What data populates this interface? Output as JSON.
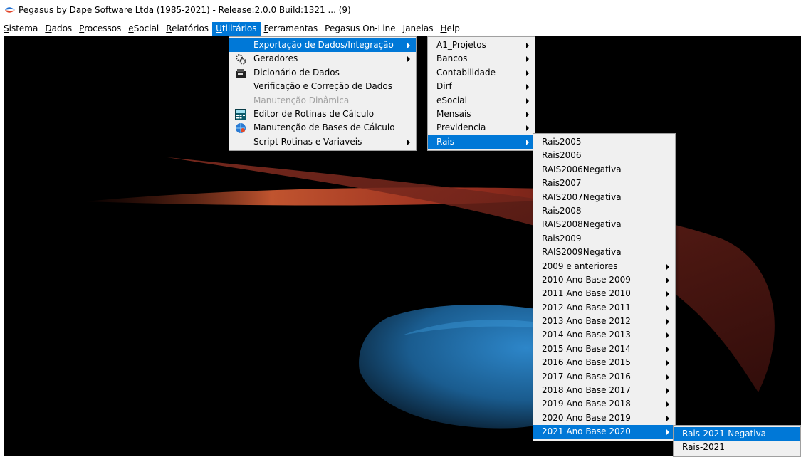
{
  "window": {
    "title": "Pegasus by Dape Software Ltda (1985-2021) - Release:2.0.0  Build:1321 ... (9)"
  },
  "menubar": [
    {
      "id": "sistema",
      "label": "Sistema",
      "ul": "S",
      "rest": "istema"
    },
    {
      "id": "dados",
      "label": "Dados",
      "ul": "D",
      "rest": "ados"
    },
    {
      "id": "processos",
      "label": "Processos",
      "ul": "P",
      "rest": "rocessos"
    },
    {
      "id": "esocial",
      "label": "eSocial",
      "ul": "e",
      "rest": "Social"
    },
    {
      "id": "relatorios",
      "label": "Relatórios",
      "ul": "R",
      "rest": "elatórios"
    },
    {
      "id": "utilitarios",
      "label": "Utilitários",
      "ul": "U",
      "rest": "tilitários",
      "active": true
    },
    {
      "id": "ferramentas",
      "label": "Ferramentas",
      "ul": "F",
      "rest": "erramentas"
    },
    {
      "id": "pegasus-online",
      "label": "Pegasus On-Line",
      "pre": "Pe",
      "ul": "g",
      "rest": "asus On-Line"
    },
    {
      "id": "janelas",
      "label": "Janelas",
      "ul": "J",
      "rest": "anelas"
    },
    {
      "id": "help",
      "label": "Help",
      "ul": "H",
      "rest": "elp"
    }
  ],
  "utilitarios_menu": [
    {
      "id": "exportacao",
      "label": "Exportação de Dados/Integração",
      "sub": true,
      "sel": true,
      "icon": ""
    },
    {
      "id": "geradores",
      "label": "Geradores",
      "sub": true,
      "icon": "gears-icon"
    },
    {
      "id": "dicionario",
      "label": "Dicionário de Dados",
      "icon": "folder-icon"
    },
    {
      "id": "verificacao",
      "label": "Verificação e Correção de Dados",
      "icon": ""
    },
    {
      "id": "manutencao-dinamica",
      "label": "Manutenção Dinâmica",
      "disabled": true,
      "icon": ""
    },
    {
      "id": "editor-rotinas",
      "label": "Editor de Rotinas de Cálculo",
      "icon": "calculator-icon"
    },
    {
      "id": "manutencao-bases",
      "label": "Manutenção de Bases de Cálculo",
      "icon": "globe-person-icon"
    },
    {
      "id": "script-rotinas",
      "label": "Script Rotinas e Variaveis",
      "sub": true,
      "icon": ""
    }
  ],
  "exportacao_menu": [
    {
      "id": "a1-projetos",
      "label": "A1_Projetos",
      "sub": true
    },
    {
      "id": "bancos",
      "label": "Bancos",
      "sub": true
    },
    {
      "id": "contabilidade",
      "label": "Contabilidade",
      "sub": true
    },
    {
      "id": "dirf",
      "label": "Dirf",
      "sub": true
    },
    {
      "id": "esocial",
      "label": "eSocial",
      "sub": true
    },
    {
      "id": "mensais",
      "label": "Mensais",
      "sub": true
    },
    {
      "id": "previdencia",
      "label": "Previdencia",
      "sub": true
    },
    {
      "id": "rais",
      "label": "Rais",
      "sub": true,
      "sel": true
    }
  ],
  "rais_menu": [
    {
      "id": "rais2005",
      "label": "Rais2005"
    },
    {
      "id": "rais2006",
      "label": "Rais2006"
    },
    {
      "id": "rais2006negativa",
      "label": "RAIS2006Negativa"
    },
    {
      "id": "rais2007",
      "label": "Rais2007"
    },
    {
      "id": "rais2007negativa",
      "label": "RAIS2007Negativa"
    },
    {
      "id": "rais2008",
      "label": "Rais2008"
    },
    {
      "id": "rais2008negativa",
      "label": "RAIS2008Negativa"
    },
    {
      "id": "rais2009",
      "label": "Rais2009"
    },
    {
      "id": "rais2009negativa",
      "label": "RAIS2009Negativa"
    },
    {
      "id": "2009-anteriores",
      "label": "2009 e anteriores",
      "sub": true
    },
    {
      "id": "2010-ab-2009",
      "label": "2010 Ano Base 2009",
      "sub": true
    },
    {
      "id": "2011-ab-2010",
      "label": "2011 Ano Base 2010",
      "sub": true
    },
    {
      "id": "2012-ab-2011",
      "label": "2012 Ano Base 2011",
      "sub": true
    },
    {
      "id": "2013-ab-2012",
      "label": "2013 Ano Base 2012",
      "sub": true
    },
    {
      "id": "2014-ab-2013",
      "label": "2014 Ano Base 2013",
      "sub": true
    },
    {
      "id": "2015-ab-2014",
      "label": "2015 Ano Base 2014",
      "sub": true
    },
    {
      "id": "2016-ab-2015",
      "label": "2016 Ano Base 2015",
      "sub": true
    },
    {
      "id": "2017-ab-2016",
      "label": "2017 Ano Base 2016",
      "sub": true
    },
    {
      "id": "2018-ab-2017",
      "label": "2018 Ano Base 2017",
      "sub": true
    },
    {
      "id": "2019-ab-2018",
      "label": "2019 Ano Base 2018",
      "sub": true
    },
    {
      "id": "2020-ab-2019",
      "label": "2020 Ano Base 2019",
      "sub": true
    },
    {
      "id": "2021-ab-2020",
      "label": "2021 Ano Base 2020",
      "sub": true,
      "sel": true
    }
  ],
  "rais2021_menu": [
    {
      "id": "rais-2021-negativa",
      "label": "Rais-2021-Negativa",
      "sel": true
    },
    {
      "id": "rais-2021",
      "label": "Rais-2021"
    }
  ],
  "colors": {
    "accent": "#0078d7",
    "menu_bg": "#f0f0f0",
    "desktop_bg": "#000000"
  }
}
